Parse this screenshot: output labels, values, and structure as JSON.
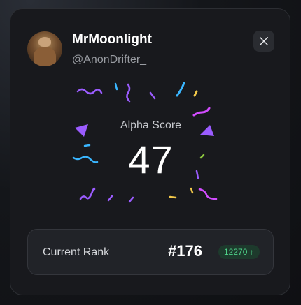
{
  "profile": {
    "name": "MrMoonlight",
    "handle": "@AnonDrifter_"
  },
  "icons": {
    "share": "x-logo-icon",
    "trend": "arrow-up-icon"
  },
  "score": {
    "label": "Alpha Score",
    "value": "47"
  },
  "rank": {
    "label": "Current Rank",
    "value": "#176",
    "change": "12270",
    "change_arrow": "↑"
  },
  "colors": {
    "card_bg": "#18191d",
    "accent_green": "#4fd38a",
    "confetti_purple": "#9b5cff",
    "confetti_blue": "#3ab6ff",
    "confetti_pink": "#d24cff",
    "confetti_yellow": "#f3c94a"
  }
}
